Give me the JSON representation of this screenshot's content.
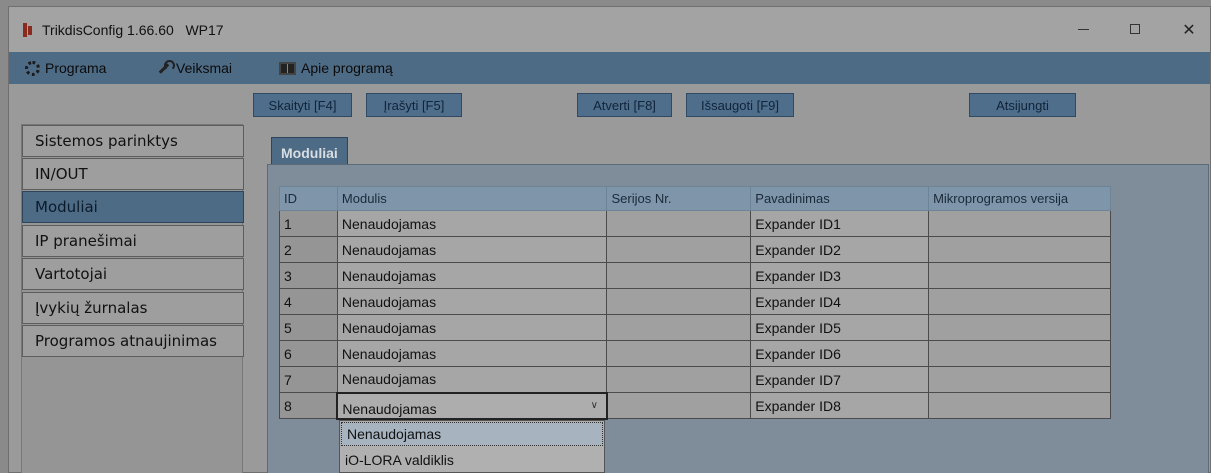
{
  "window": {
    "title": "TrikdisConfig 1.66.60   WP17"
  },
  "menubar": {
    "items": [
      {
        "label": "Programa",
        "icon": "gear-icon"
      },
      {
        "label": "Veiksmai",
        "icon": "wrench-icon"
      },
      {
        "label": "Apie programą",
        "icon": "book-icon"
      }
    ]
  },
  "toolbar": {
    "read": "Skaityti [F4]",
    "write": "Įrašyti [F5]",
    "open": "Atverti [F8]",
    "save": "Išsaugoti [F9]",
    "disconnect": "Atsijungti"
  },
  "sidebar": {
    "items": [
      {
        "label": "Sistemos parinktys"
      },
      {
        "label": "IN/OUT"
      },
      {
        "label": "Moduliai",
        "active": true
      },
      {
        "label": "IP pranešimai"
      },
      {
        "label": "Vartotojai"
      },
      {
        "label": "Įvykių žurnalas"
      },
      {
        "label": "Programos atnaujinimas"
      }
    ]
  },
  "tab": {
    "label": "Moduliai"
  },
  "table": {
    "columns": [
      "ID",
      "Modulis",
      "Serijos Nr.",
      "Pavadinimas",
      "Mikroprogramos versija"
    ],
    "rows": [
      {
        "id": "1",
        "module": "Nenaudojamas",
        "serial": "",
        "name": "Expander ID1",
        "version": ""
      },
      {
        "id": "2",
        "module": "Nenaudojamas",
        "serial": "",
        "name": "Expander ID2",
        "version": ""
      },
      {
        "id": "3",
        "module": "Nenaudojamas",
        "serial": "",
        "name": "Expander ID3",
        "version": ""
      },
      {
        "id": "4",
        "module": "Nenaudojamas",
        "serial": "",
        "name": "Expander ID4",
        "version": ""
      },
      {
        "id": "5",
        "module": "Nenaudojamas",
        "serial": "",
        "name": "Expander ID5",
        "version": ""
      },
      {
        "id": "6",
        "module": "Nenaudojamas",
        "serial": "",
        "name": "Expander ID6",
        "version": ""
      },
      {
        "id": "7",
        "module": "Nenaudojamas",
        "serial": "",
        "name": "Expander ID7",
        "version": ""
      },
      {
        "id": "8",
        "module": "Nenaudojamas",
        "serial": "",
        "name": "Expander ID8",
        "version": ""
      }
    ]
  },
  "dropdown": {
    "options": [
      "Nenaudojamas",
      "iO-LORA valdiklis"
    ]
  },
  "colors": {
    "accent": "#4e6b85",
    "overlay_gray": "#9a9a9a"
  }
}
